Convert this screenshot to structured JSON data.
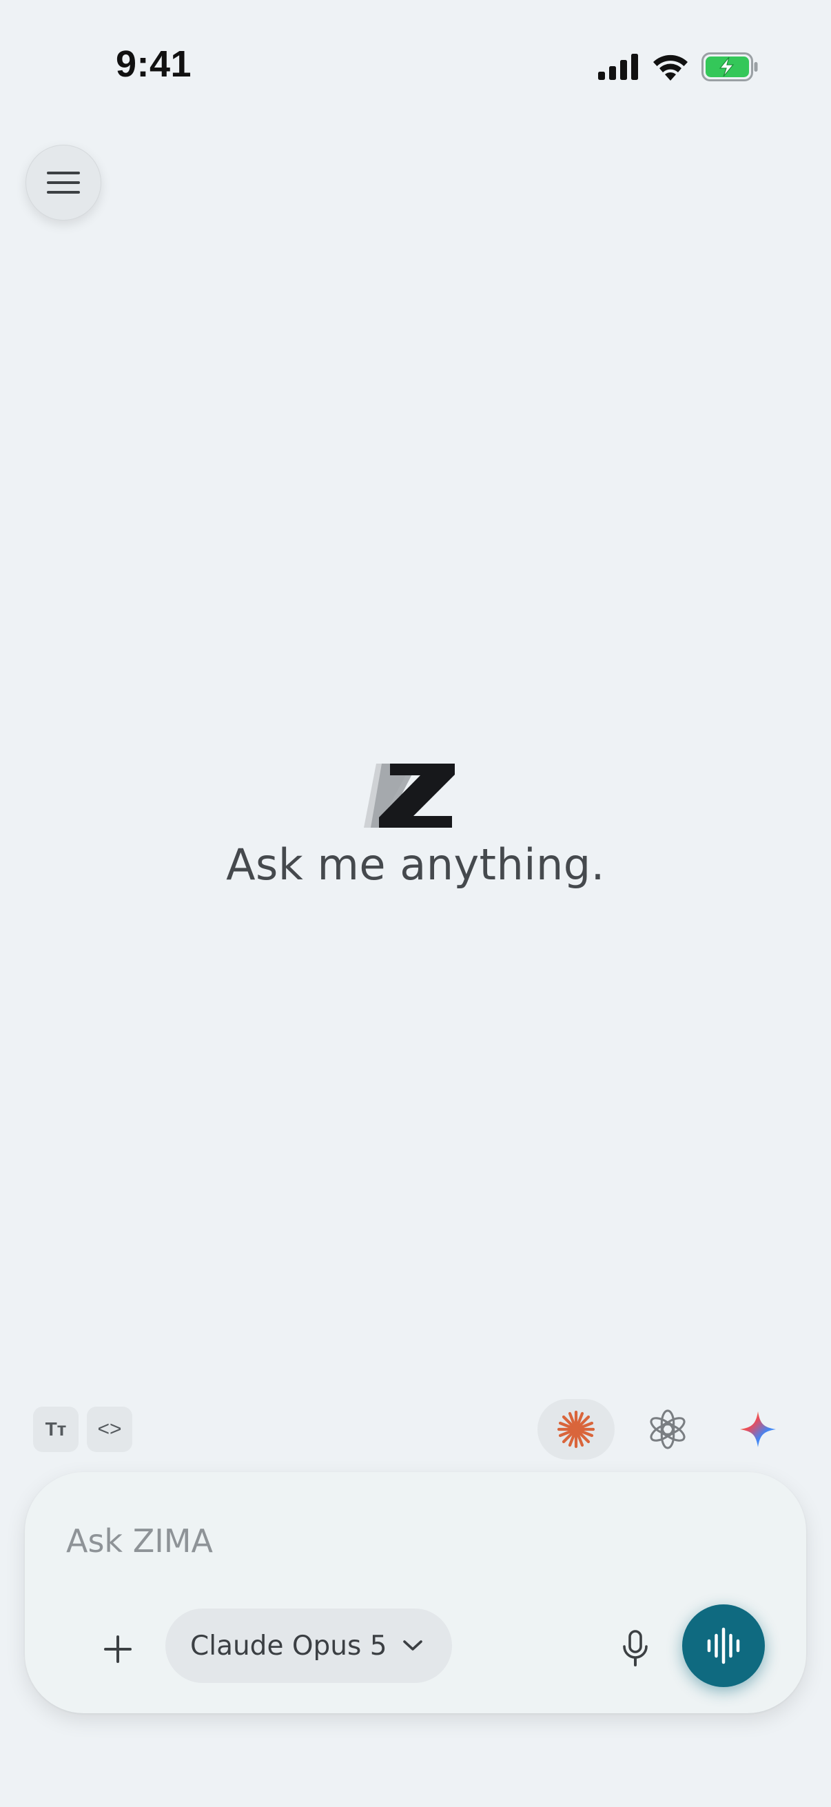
{
  "status_bar": {
    "time": "9:41",
    "signal_icon": "cellular-signal-icon",
    "wifi_icon": "wifi-icon",
    "battery_icon": "battery-charging-icon",
    "battery_color": "#34c759"
  },
  "header": {
    "menu_icon": "hamburger-menu-icon"
  },
  "hero": {
    "logo": "Z",
    "tagline": "Ask me anything."
  },
  "toolbar": {
    "text_size_label": "Tт",
    "code_label": "<>",
    "providers": [
      {
        "name": "claude-icon",
        "selected": true,
        "color": "#d9653b"
      },
      {
        "name": "openai-icon",
        "selected": false,
        "color": "#7a7e82"
      },
      {
        "name": "gemini-icon",
        "selected": false,
        "color": "#4285f4"
      }
    ]
  },
  "composer": {
    "placeholder": "Ask ZIMA",
    "value": "",
    "add_icon": "plus-icon",
    "model_label": "Claude Opus 5",
    "model_dropdown_icon": "chevron-down-icon",
    "mic_icon": "microphone-icon",
    "voice_icon": "voice-waveform-icon",
    "voice_button_color": "#0f6a80"
  }
}
